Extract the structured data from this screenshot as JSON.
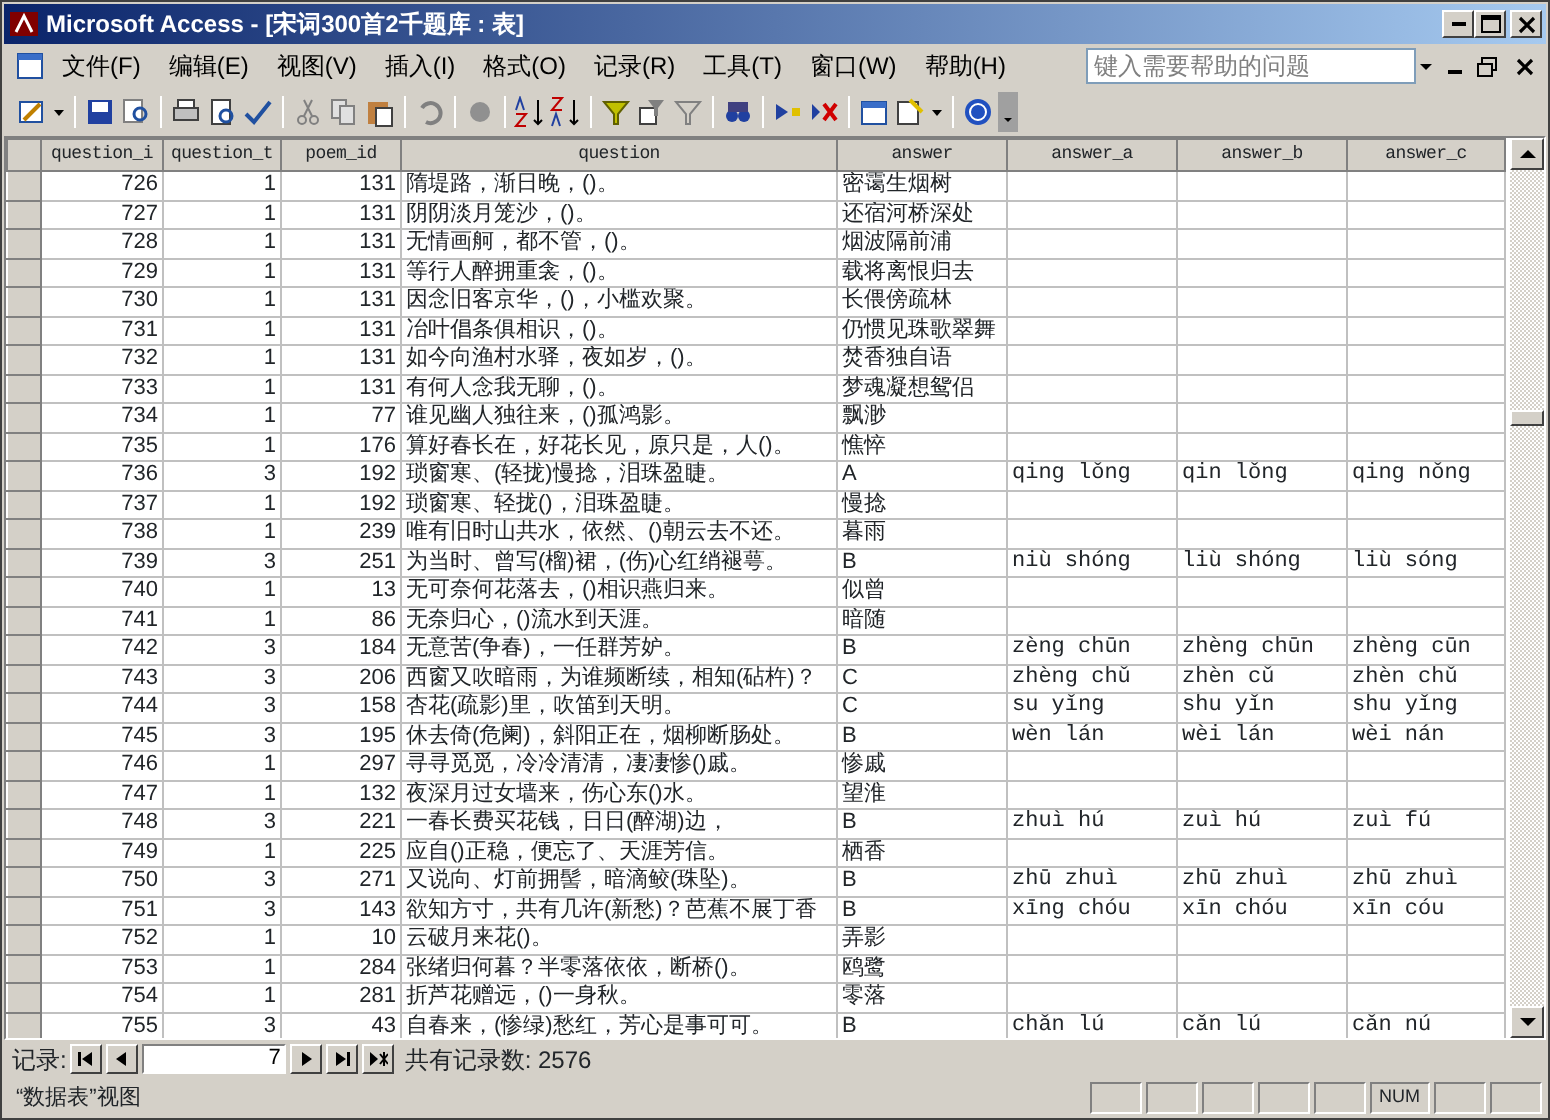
{
  "window": {
    "title": "Microsoft Access - [宋词300首2千题库 : 表]"
  },
  "menu": [
    "文件(F)",
    "编辑(E)",
    "视图(V)",
    "插入(I)",
    "格式(O)",
    "记录(R)",
    "工具(T)",
    "窗口(W)",
    "帮助(H)"
  ],
  "help_box": {
    "placeholder": "键入需要帮助的问题"
  },
  "table": {
    "columns": [
      "question_i",
      "question_t",
      "poem_id",
      "question",
      "answer",
      "answer_a",
      "answer_b",
      "answer_c"
    ],
    "rows": [
      {
        "question_id": "726",
        "question_type": "1",
        "poem_id": "131",
        "question": "隋堤路，渐日晚，()。",
        "answer": "密霭生烟树"
      },
      {
        "question_id": "727",
        "question_type": "1",
        "poem_id": "131",
        "question": "阴阴淡月笼沙，()。",
        "answer": "还宿河桥深处"
      },
      {
        "question_id": "728",
        "question_type": "1",
        "poem_id": "131",
        "question": "无情画舸，都不管，()。",
        "answer": "烟波隔前浦"
      },
      {
        "question_id": "729",
        "question_type": "1",
        "poem_id": "131",
        "question": "等行人醉拥重衾，()。",
        "answer": "载将离恨归去"
      },
      {
        "question_id": "730",
        "question_type": "1",
        "poem_id": "131",
        "question": "因念旧客京华，()，小槛欢聚。",
        "answer": "长偎傍疏林"
      },
      {
        "question_id": "731",
        "question_type": "1",
        "poem_id": "131",
        "question": "冶叶倡条俱相识，()。",
        "answer": "仍惯见珠歌翠舞"
      },
      {
        "question_id": "732",
        "question_type": "1",
        "poem_id": "131",
        "question": "如今向渔村水驿，夜如岁，()。",
        "answer": "焚香独自语"
      },
      {
        "question_id": "733",
        "question_type": "1",
        "poem_id": "131",
        "question": "有何人念我无聊，()。",
        "answer": "梦魂凝想鸳侣"
      },
      {
        "question_id": "734",
        "question_type": "1",
        "poem_id": "77",
        "question": "谁见幽人独往来，()孤鸿影。",
        "answer": "飘渺"
      },
      {
        "question_id": "735",
        "question_type": "1",
        "poem_id": "176",
        "question": "算好春长在，好花长见，原只是，人()。",
        "answer": "憔悴"
      },
      {
        "question_id": "736",
        "question_type": "3",
        "poem_id": "192",
        "question": "琐窗寒、(轻拢)慢捻，泪珠盈睫。",
        "answer": "A",
        "answer_a": "qing lǒng",
        "answer_b": "qin lǒng",
        "answer_c": "qing nǒng"
      },
      {
        "question_id": "737",
        "question_type": "1",
        "poem_id": "192",
        "question": "琐窗寒、轻拢()，泪珠盈睫。",
        "answer": "慢捻"
      },
      {
        "question_id": "738",
        "question_type": "1",
        "poem_id": "239",
        "question": "唯有旧时山共水，依然、()朝云去不还。",
        "answer": "暮雨"
      },
      {
        "question_id": "739",
        "question_type": "3",
        "poem_id": "251",
        "question": "为当时、曾写(榴)裙，(伤)心红绡褪萼。",
        "answer": "B",
        "answer_a": "niù shóng",
        "answer_b": "liù shóng",
        "answer_c": "liù sóng"
      },
      {
        "question_id": "740",
        "question_type": "1",
        "poem_id": "13",
        "question": "无可奈何花落去，()相识燕归来。",
        "answer": "似曾"
      },
      {
        "question_id": "741",
        "question_type": "1",
        "poem_id": "86",
        "question": "无奈归心，()流水到天涯。",
        "answer": "暗随"
      },
      {
        "question_id": "742",
        "question_type": "3",
        "poem_id": "184",
        "question": "无意苦(争春)，一任群芳妒。",
        "answer": "B",
        "answer_a": "zèng chūn",
        "answer_b": "zhèng chūn",
        "answer_c": "zhèng cūn"
      },
      {
        "question_id": "743",
        "question_type": "3",
        "poem_id": "206",
        "question": "西窗又吹暗雨，为谁频断续，相知(砧杵)？",
        "answer": "C",
        "answer_a": "zhèng chǔ",
        "answer_b": "zhèn cǔ",
        "answer_c": "zhèn chǔ"
      },
      {
        "question_id": "744",
        "question_type": "3",
        "poem_id": "158",
        "question": "杏花(疏影)里，吹笛到天明。",
        "answer": "C",
        "answer_a": "su yǐng",
        "answer_b": "shu yǐn",
        "answer_c": "shu yǐng"
      },
      {
        "question_id": "745",
        "question_type": "3",
        "poem_id": "195",
        "question": "休去倚(危阑)，斜阳正在，烟柳断肠处。",
        "answer": "B",
        "answer_a": "wèn lán",
        "answer_b": "wèi lán",
        "answer_c": "wèi nán"
      },
      {
        "question_id": "746",
        "question_type": "1",
        "poem_id": "297",
        "question": "寻寻觅觅，冷冷清清，凄凄惨()戚。",
        "answer": "惨戚"
      },
      {
        "question_id": "747",
        "question_type": "1",
        "poem_id": "132",
        "question": "夜深月过女墙来，伤心东()水。",
        "answer": "望淮"
      },
      {
        "question_id": "748",
        "question_type": "3",
        "poem_id": "221",
        "question": "一春长费买花钱，日日(醉湖)边，",
        "answer": "B",
        "answer_a": "zhuì hú",
        "answer_b": "zuì hú",
        "answer_c": "zuì fú"
      },
      {
        "question_id": "749",
        "question_type": "1",
        "poem_id": "225",
        "question": "应自()正稳，便忘了、天涯芳信。",
        "answer": "栖香"
      },
      {
        "question_id": "750",
        "question_type": "3",
        "poem_id": "271",
        "question": "又说向、灯前拥髻，暗滴鲛(珠坠)。",
        "answer": "B",
        "answer_a": "zhū zhuì",
        "answer_b": "zhū zhuì",
        "answer_c": "zhū zhuì"
      },
      {
        "question_id": "751",
        "question_type": "3",
        "poem_id": "143",
        "question": "欲知方寸，共有几许(新愁)？芭蕉不展丁香",
        "answer": "B",
        "answer_a": "xīng chóu",
        "answer_b": "xīn chóu",
        "answer_c": "xīn cóu"
      },
      {
        "question_id": "752",
        "question_type": "1",
        "poem_id": "10",
        "question": "云破月来花()。",
        "answer": "弄影"
      },
      {
        "question_id": "753",
        "question_type": "1",
        "poem_id": "284",
        "question": "张绪归何暮？半零落依依，断桥()。",
        "answer": "鸥鹭"
      },
      {
        "question_id": "754",
        "question_type": "1",
        "poem_id": "281",
        "question": "折芦花赠远，()一身秋。",
        "answer": "零落"
      },
      {
        "question_id": "755",
        "question_type": "3",
        "poem_id": "43",
        "question": "自春来，(惨绿)愁红，芳心是事可可。",
        "answer": "B",
        "answer_a": "chǎn lú",
        "answer_b": "cǎn lú",
        "answer_c": "cǎn nú"
      }
    ]
  },
  "record_nav": {
    "label": "记录:",
    "current": "7",
    "total": "共有记录数: 2576"
  },
  "status_bar": {
    "mode": "“数据表”视图",
    "indicator": "NUM"
  }
}
